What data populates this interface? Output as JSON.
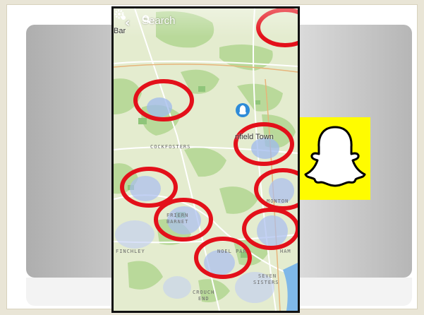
{
  "map_header": {
    "back_icon": "chevron-left-icon",
    "search_label": "Search",
    "search_icon": "search-icon",
    "settings_icon": "gear-icon",
    "location_fragment": "Bar"
  },
  "places": {
    "cockfosters": "COCKFOSTERS",
    "enfield_town": "nfield Town",
    "friern": "FRIERN",
    "barnet": "BARNET",
    "finchley": "FINCHLEY",
    "noel_park": "NOEL PAR",
    "edmonton": "MONTON",
    "seven": "SEVEN",
    "sisters": "SISTERS",
    "crouch": "CROUCH",
    "end": "END",
    "tottenham_fragment": "HAM"
  },
  "annotation": {
    "highlight_color": "#e3101a",
    "count": 9
  },
  "brand": {
    "logo": "snapchat-ghost-logo",
    "color": "#fffc00"
  }
}
